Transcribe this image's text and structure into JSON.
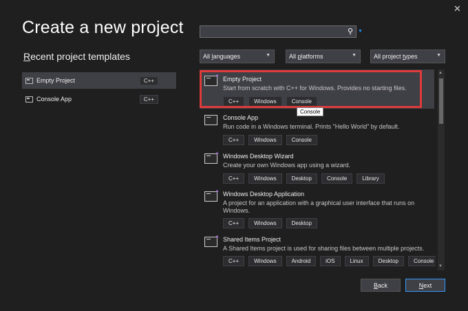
{
  "window": {
    "close_glyph": "✕"
  },
  "title": "Create a new project",
  "recent": {
    "heading_underlined": "R",
    "heading_rest": "ecent project templates",
    "items": [
      {
        "label": "Empty Project",
        "lang": "C++",
        "icon": "empty-project-icon"
      },
      {
        "label": "Console App",
        "lang": "C++",
        "icon": "console-app-icon"
      }
    ]
  },
  "search": {
    "value": "",
    "icon": "search-icon"
  },
  "filters": {
    "language": {
      "prefix": "All ",
      "underlined": "l",
      "rest": "anguages"
    },
    "platform": {
      "prefix": "All ",
      "underlined": "p",
      "rest": "latforms"
    },
    "project_type": {
      "prefix": "All project ",
      "underlined": "t",
      "rest": "ypes"
    }
  },
  "templates": [
    {
      "name": "Empty Project",
      "description": "Start from scratch with C++ for Windows. Provides no starting files.",
      "tags": [
        "C++",
        "Windows",
        "Console"
      ]
    },
    {
      "name": "Console App",
      "description": "Run code in a Windows terminal. Prints \"Hello World\" by default.",
      "tags": [
        "C++",
        "Windows",
        "Console"
      ]
    },
    {
      "name": "Windows Desktop Wizard",
      "description": "Create your own Windows app using a wizard.",
      "tags": [
        "C++",
        "Windows",
        "Desktop",
        "Console",
        "Library"
      ]
    },
    {
      "name": "Windows Desktop Application",
      "description": "A project for an application with a graphical user interface that runs on Windows.",
      "tags": [
        "C++",
        "Windows",
        "Desktop"
      ]
    },
    {
      "name": "Shared Items Project",
      "description": "A Shared Items project is used for sharing files between multiple projects.",
      "tags": [
        "C++",
        "Windows",
        "Android",
        "iOS",
        "Linux",
        "Desktop",
        "Console"
      ]
    }
  ],
  "tooltip": "Console",
  "buttons": {
    "back": {
      "underlined": "B",
      "rest": "ack"
    },
    "next": {
      "underlined": "N",
      "rest": "ext"
    }
  },
  "colors": {
    "highlight": "#e03b3b",
    "accent": "#3399ff",
    "icon_spark": "#b180d7"
  }
}
